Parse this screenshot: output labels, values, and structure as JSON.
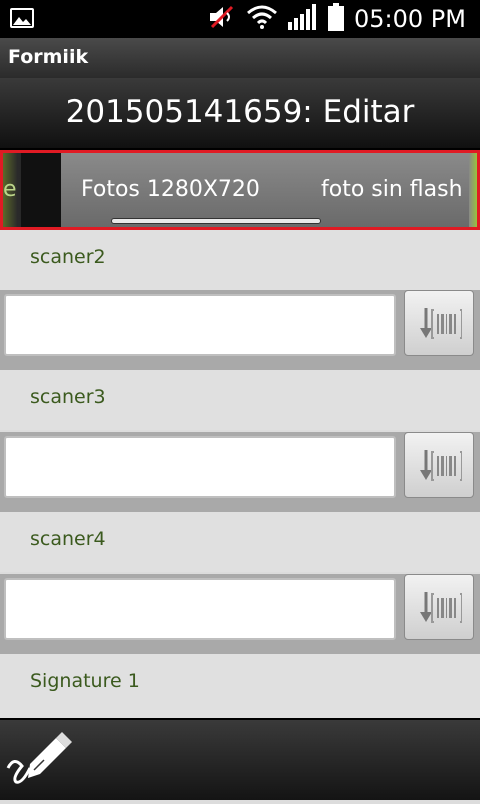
{
  "status_bar": {
    "time": "05:00 PM",
    "icons": [
      "gallery-icon",
      "mute-icon",
      "wifi-icon",
      "signal-icon",
      "battery-icon"
    ]
  },
  "app": {
    "title": "Formiik"
  },
  "header": {
    "title": "201505141659: Editar"
  },
  "tabs": {
    "partial_label": "e",
    "items": [
      {
        "label": "Fotos 1280X720"
      },
      {
        "label": "foto sin flash"
      }
    ],
    "highlight_color": "#e01b24"
  },
  "form": {
    "fields": [
      {
        "label": "scaner2",
        "value": ""
      },
      {
        "label": "scaner3",
        "value": ""
      },
      {
        "label": "scaner4",
        "value": ""
      }
    ],
    "signature_label": "Signature 1",
    "label_color": "#3b5a1e"
  },
  "bottom_bar": {
    "action_icon": "signature-icon"
  }
}
